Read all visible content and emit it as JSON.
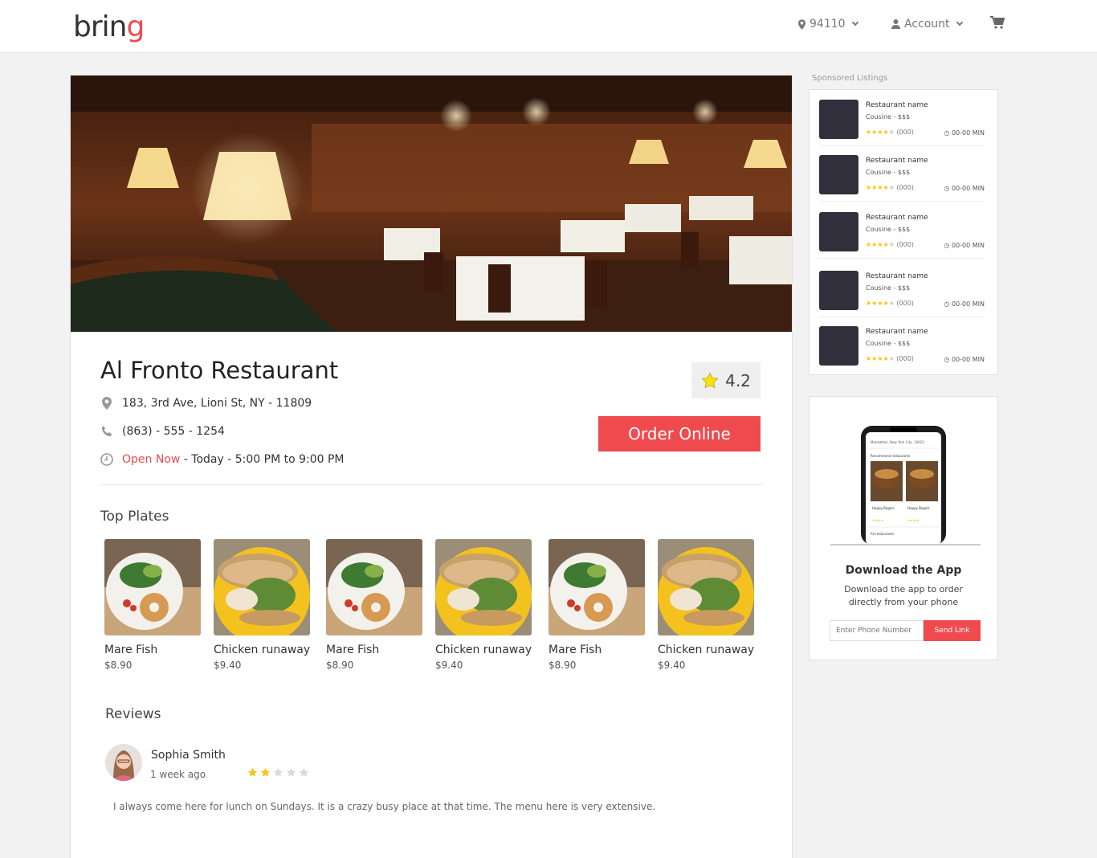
{
  "header": {
    "logo_text": "brin",
    "logo_accent": "g",
    "zip": "94110",
    "account": "Account",
    "brand_color": "#ef4b4e"
  },
  "restaurant": {
    "name": "Al Fronto Restaurant",
    "address": "183, 3rd Ave, Lioni St, NY - 11809",
    "phone": "(863) - 555 - 1254",
    "open_status": "Open Now",
    "hours": " - Today - 5:00 PM to 9:00 PM",
    "rating": "4.2",
    "order_label": "Order Online"
  },
  "top_plates": {
    "title": "Top Plates",
    "items": [
      {
        "name": "Mare Fish",
        "price": "$8.90",
        "image": "salad-bagel"
      },
      {
        "name": "Chicken runaway",
        "price": "$9.40",
        "image": "sandwich"
      },
      {
        "name": "Mare Fish",
        "price": "$8.90",
        "image": "salad-bagel"
      },
      {
        "name": "Chicken runaway",
        "price": "$9.40",
        "image": "sandwich"
      },
      {
        "name": "Mare Fish",
        "price": "$8.90",
        "image": "salad-bagel"
      },
      {
        "name": "Chicken runaway",
        "price": "$9.40",
        "image": "sandwich"
      }
    ]
  },
  "reviews": {
    "title": "Reviews",
    "items": [
      {
        "author": "Sophia Smith",
        "time": "1 week ago",
        "stars": 2,
        "max_stars": 5,
        "text": "I always come here for lunch on Sundays. It is a crazy busy place at that time. The menu here is very extensive."
      }
    ]
  },
  "sponsored": {
    "label": "Sponsored Listings",
    "items": [
      {
        "name": "Restaurant name",
        "cuisine": "Cousine - $$$",
        "stars": 4,
        "count": "(000)",
        "time": "00-00 MIN"
      },
      {
        "name": "Restaurant name",
        "cuisine": "Cousine - $$$",
        "stars": 4,
        "count": "(000)",
        "time": "00-00 MIN"
      },
      {
        "name": "Restaurant name",
        "cuisine": "Cousine - $$$",
        "stars": 4,
        "count": "(000)",
        "time": "00-00 MIN"
      },
      {
        "name": "Restaurant name",
        "cuisine": "Cousine - $$$",
        "stars": 4,
        "count": "(000)",
        "time": "00-00 MIN"
      },
      {
        "name": "Restaurant name",
        "cuisine": "Cousine - $$$",
        "stars": 4,
        "count": "(000)",
        "time": "00-00 MIN"
      }
    ]
  },
  "app_promo": {
    "title": "Download the App",
    "description": "Download the app to order directly from your phone",
    "phone_placeholder": "Enter Phone Number",
    "send_label": "Send Link",
    "mock_location": "Manhattan, New York City, 10023",
    "mock_section": "Recommend restaurants",
    "mock_card1": "Happy Bagels",
    "mock_card2": "Happy Bagels",
    "mock_footer": "All restaurants"
  }
}
